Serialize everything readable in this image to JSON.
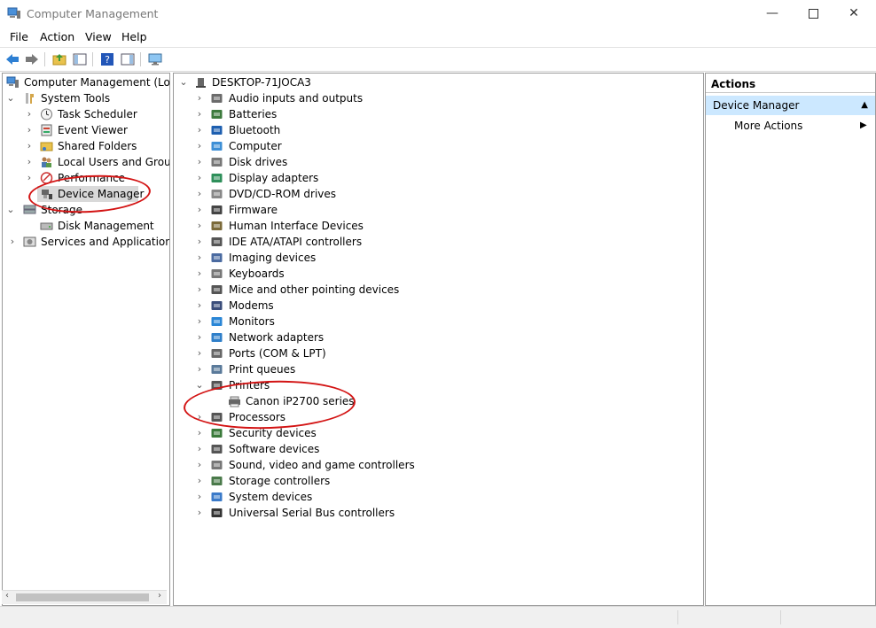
{
  "window": {
    "title": "Computer Management"
  },
  "menu": {
    "file": "File",
    "action": "Action",
    "view": "View",
    "help": "Help"
  },
  "left_tree": {
    "root": "Computer Management (Local",
    "system_tools": "System Tools",
    "task_scheduler": "Task Scheduler",
    "event_viewer": "Event Viewer",
    "shared_folders": "Shared Folders",
    "local_users": "Local Users and Groups",
    "performance": "Performance",
    "device_manager": "Device Manager",
    "storage": "Storage",
    "disk_management": "Disk Management",
    "services_apps": "Services and Applications"
  },
  "device_tree": {
    "computer_name": "DESKTOP-71JOCA3",
    "categories": [
      "Audio inputs and outputs",
      "Batteries",
      "Bluetooth",
      "Computer",
      "Disk drives",
      "Display adapters",
      "DVD/CD-ROM drives",
      "Firmware",
      "Human Interface Devices",
      "IDE ATA/ATAPI controllers",
      "Imaging devices",
      "Keyboards",
      "Mice and other pointing devices",
      "Modems",
      "Monitors",
      "Network adapters",
      "Ports (COM & LPT)",
      "Print queues",
      "Printers",
      "Processors",
      "Security devices",
      "Software devices",
      "Sound, video and game controllers",
      "Storage controllers",
      "System devices",
      "Universal Serial Bus controllers"
    ],
    "printer_child": "Canon iP2700 series"
  },
  "actions": {
    "header": "Actions",
    "selected": "Device Manager",
    "more": "More Actions"
  },
  "colors": {
    "annotation": "#d31414",
    "selection": "#cce8ff",
    "tree_select": "#d9d9d9"
  }
}
